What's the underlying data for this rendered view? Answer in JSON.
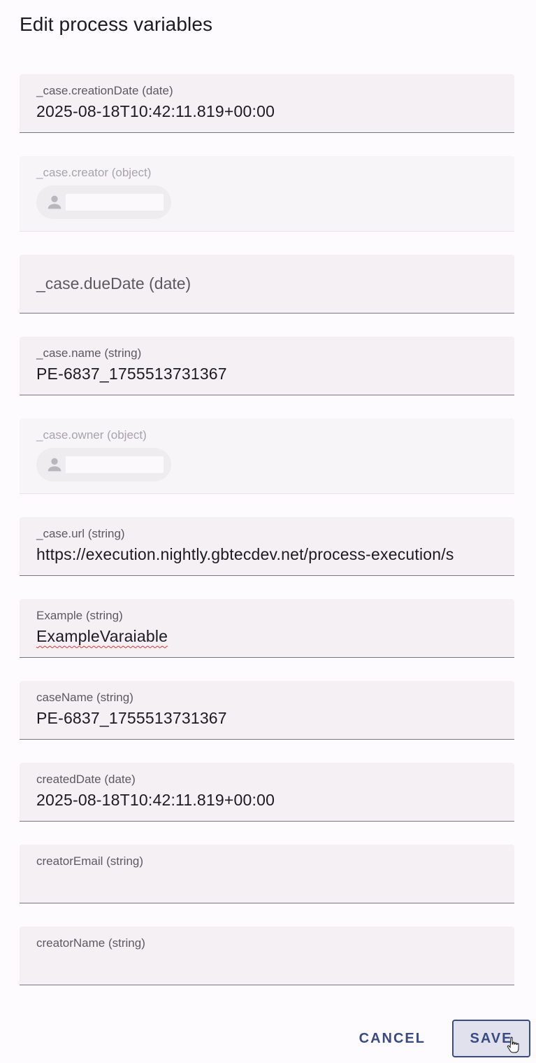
{
  "dialog": {
    "title": "Edit process variables"
  },
  "fields": {
    "creationDate": {
      "label": "_case.creationDate (date)",
      "value": "2025-08-18T10:42:11.819+00:00"
    },
    "creator": {
      "label": "_case.creator (object)",
      "icon": "person-icon"
    },
    "dueDate": {
      "label": "_case.dueDate (date)",
      "value": ""
    },
    "name": {
      "label": "_case.name (string)",
      "value": "PE-6837_1755513731367"
    },
    "owner": {
      "label": "_case.owner (object)",
      "icon": "person-icon"
    },
    "url": {
      "label": "_case.url (string)",
      "value": "https://execution.nightly.gbtecdev.net/process-execution/s"
    },
    "example": {
      "label": "Example (string)",
      "value": "ExampleVaraiable"
    },
    "caseName": {
      "label": "caseName (string)",
      "value": "PE-6837_1755513731367"
    },
    "createdDate": {
      "label": "createdDate (date)",
      "value": "2025-08-18T10:42:11.819+00:00"
    },
    "creatorEmail": {
      "label": "creatorEmail (string)",
      "value": ""
    },
    "creatorName": {
      "label": "creatorName (string)",
      "value": ""
    }
  },
  "actions": {
    "cancel_label": "CANCEL",
    "save_label": "SAVE"
  },
  "colors": {
    "accent": "#3a4a82",
    "field_bg": "#f4f0f4",
    "spellcheck": "#e53935"
  }
}
